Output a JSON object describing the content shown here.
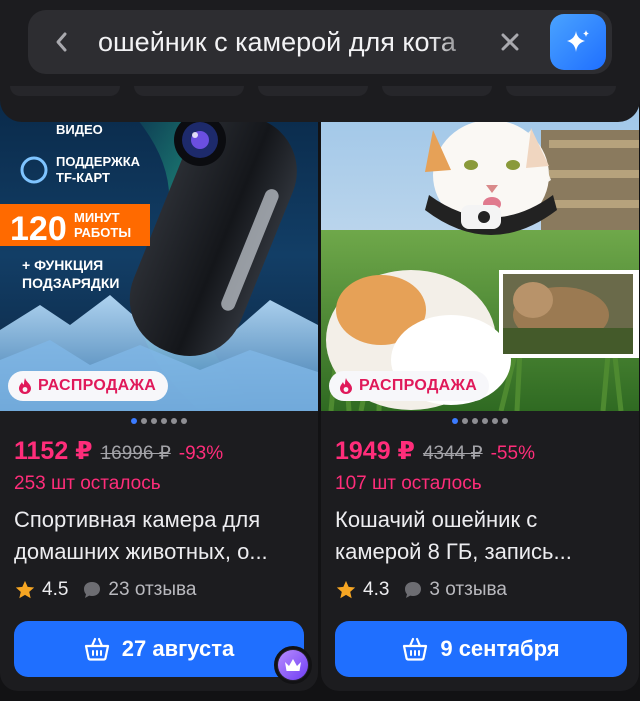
{
  "search": {
    "query": "ошейник с камерой для кота",
    "back_icon": "chevron-left-icon",
    "clear_icon": "close-icon",
    "ai_icon": "sparkles-icon"
  },
  "colors": {
    "accent": "#1f6fff",
    "price": "#ff2d7a",
    "sale_text": "#e0195a",
    "background": "#121214",
    "card": "#1c1c1f"
  },
  "products": [
    {
      "photo_texts": [
        "РАЗРЕШЕНИЕ ВИДЕО",
        "ПОДДЕРЖКА TF-КАРТ",
        "120",
        "МИНУТ РАБОТЫ",
        "+ ФУНКЦИЯ ПОДЗАРЯДКИ"
      ],
      "badge": "РАСПРОДАЖА",
      "dots_total": 6,
      "dots_active": 0,
      "price": "1152 ₽",
      "old_price": "16996 ₽",
      "discount": "-93%",
      "stock": "253 шт осталось",
      "title_line1": "Спортивная камера для",
      "title_line2": "домашних животных, о...",
      "rating": "4.5",
      "reviews": "23 отзыва",
      "delivery": "27 августа"
    },
    {
      "badge": "РАСПРОДАЖА",
      "dots_total": 6,
      "dots_active": 0,
      "price": "1949 ₽",
      "old_price": "4344 ₽",
      "discount": "-55%",
      "stock": "107 шт осталось",
      "title_line1": "Кошачий ошейник с",
      "title_line2": "камерой 8 ГБ, запись...",
      "rating": "4.3",
      "reviews": "3 отзыва",
      "delivery": "9 сентября"
    }
  ]
}
